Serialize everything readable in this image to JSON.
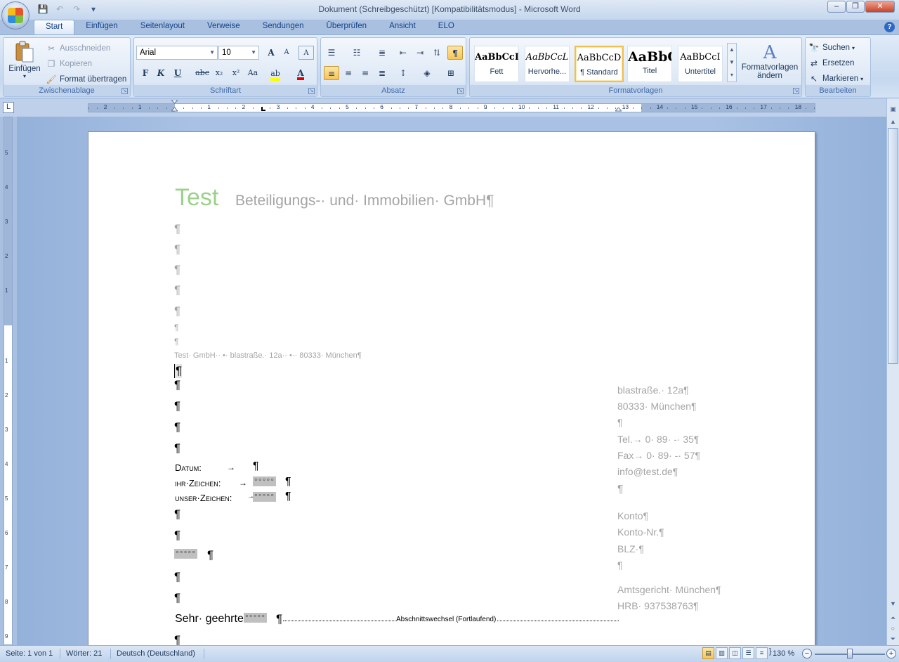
{
  "window": {
    "title": "Dokument (Schreibgeschützt) [Kompatibilitätsmodus] - Microsoft Word",
    "controls": {
      "minimize": "–",
      "restore": "❐",
      "close": "✕"
    }
  },
  "quick_access": {
    "save_icon": "💾",
    "undo_icon": "↶",
    "redo_icon": "↷",
    "customize_icon": "▾"
  },
  "tabs": [
    "Start",
    "Einfügen",
    "Seitenlayout",
    "Verweise",
    "Sendungen",
    "Überprüfen",
    "Ansicht",
    "ELO"
  ],
  "active_tab": "Start",
  "ribbon": {
    "clipboard": {
      "label": "Zwischenablage",
      "paste": "Einfügen",
      "cut": "Ausschneiden",
      "copy": "Kopieren",
      "format_painter": "Format übertragen"
    },
    "font": {
      "label": "Schriftart",
      "font_name": "Arial",
      "font_size": "10",
      "bold": "F",
      "italic": "K",
      "underline": "U",
      "strikethrough": "abc",
      "subscript": "x₂",
      "superscript": "x²",
      "change_case": "Aa",
      "grow": "A",
      "shrink": "A",
      "clear": "A"
    },
    "paragraph": {
      "label": "Absatz",
      "show_marks": "¶"
    },
    "styles": {
      "label": "Formatvorlagen",
      "items": [
        {
          "sample": "AaBbCcI",
          "name": "Fett"
        },
        {
          "sample": "AaBbCcL",
          "name": "Hervorhe..."
        },
        {
          "sample": "AaBbCcD",
          "name": "¶ Standard"
        },
        {
          "sample": "AaBbC",
          "name": "Titel"
        },
        {
          "sample": "AaBbCcI",
          "name": "Untertitel"
        }
      ],
      "change_styles": "Formatvorlagen ändern"
    },
    "editing": {
      "label": "Bearbeiten",
      "find": "Suchen",
      "replace": "Ersetzen",
      "select": "Markieren"
    }
  },
  "ruler": {
    "corner": "L",
    "numbers": [
      "2",
      "1",
      "1",
      "2",
      "3",
      "4",
      "5",
      "6",
      "7",
      "8",
      "9",
      "10",
      "11",
      "12",
      "13",
      "14",
      "15",
      "16",
      "17",
      "18"
    ],
    "v_numbers": [
      "5",
      "4",
      "3",
      "2",
      "1",
      "1",
      "2",
      "3",
      "4",
      "5",
      "6",
      "7",
      "8",
      "9"
    ]
  },
  "document": {
    "company_name_green": "Test",
    "company_name_rest": "Beteiligungs-· und· Immobilien· GmbH¶",
    "sender_line": "Test· GmbH·· •· blastraße.· 12a·· •·· 80333· München¶",
    "pilcrow": "¶",
    "datum_label": "Datum:",
    "ihr_zeichen_label": "ihr·Zeichen:",
    "unser_zeichen_label": "unser·Zeichen:",
    "field_placeholder": "°°°°°",
    "salutation": "Sehr· geehrte",
    "section_break": "Abschnittswechsel (Fortlaufend)",
    "tab_arrow": "→",
    "right_column": [
      "blastraße.· 12a¶",
      "80333· München¶",
      "¶",
      "Tel.→ 0· 89· -· 35¶",
      "Fax→ 0· 89· -· 57¶",
      "info@test.de¶",
      "¶",
      "Konto¶",
      "Konto-Nr.¶",
      "BLZ·¶",
      "¶",
      "Amtsgericht· München¶",
      "HRB· 937538763¶"
    ]
  },
  "statusbar": {
    "page": "Seite: 1 von 1",
    "words": "Wörter: 21",
    "language": "Deutsch (Deutschland)",
    "zoom": "130 %"
  },
  "colors": {
    "accent_green": "#9bd18a",
    "ribbon_blue": "#c6d8ef",
    "doc_grey": "#a5a5a5"
  }
}
